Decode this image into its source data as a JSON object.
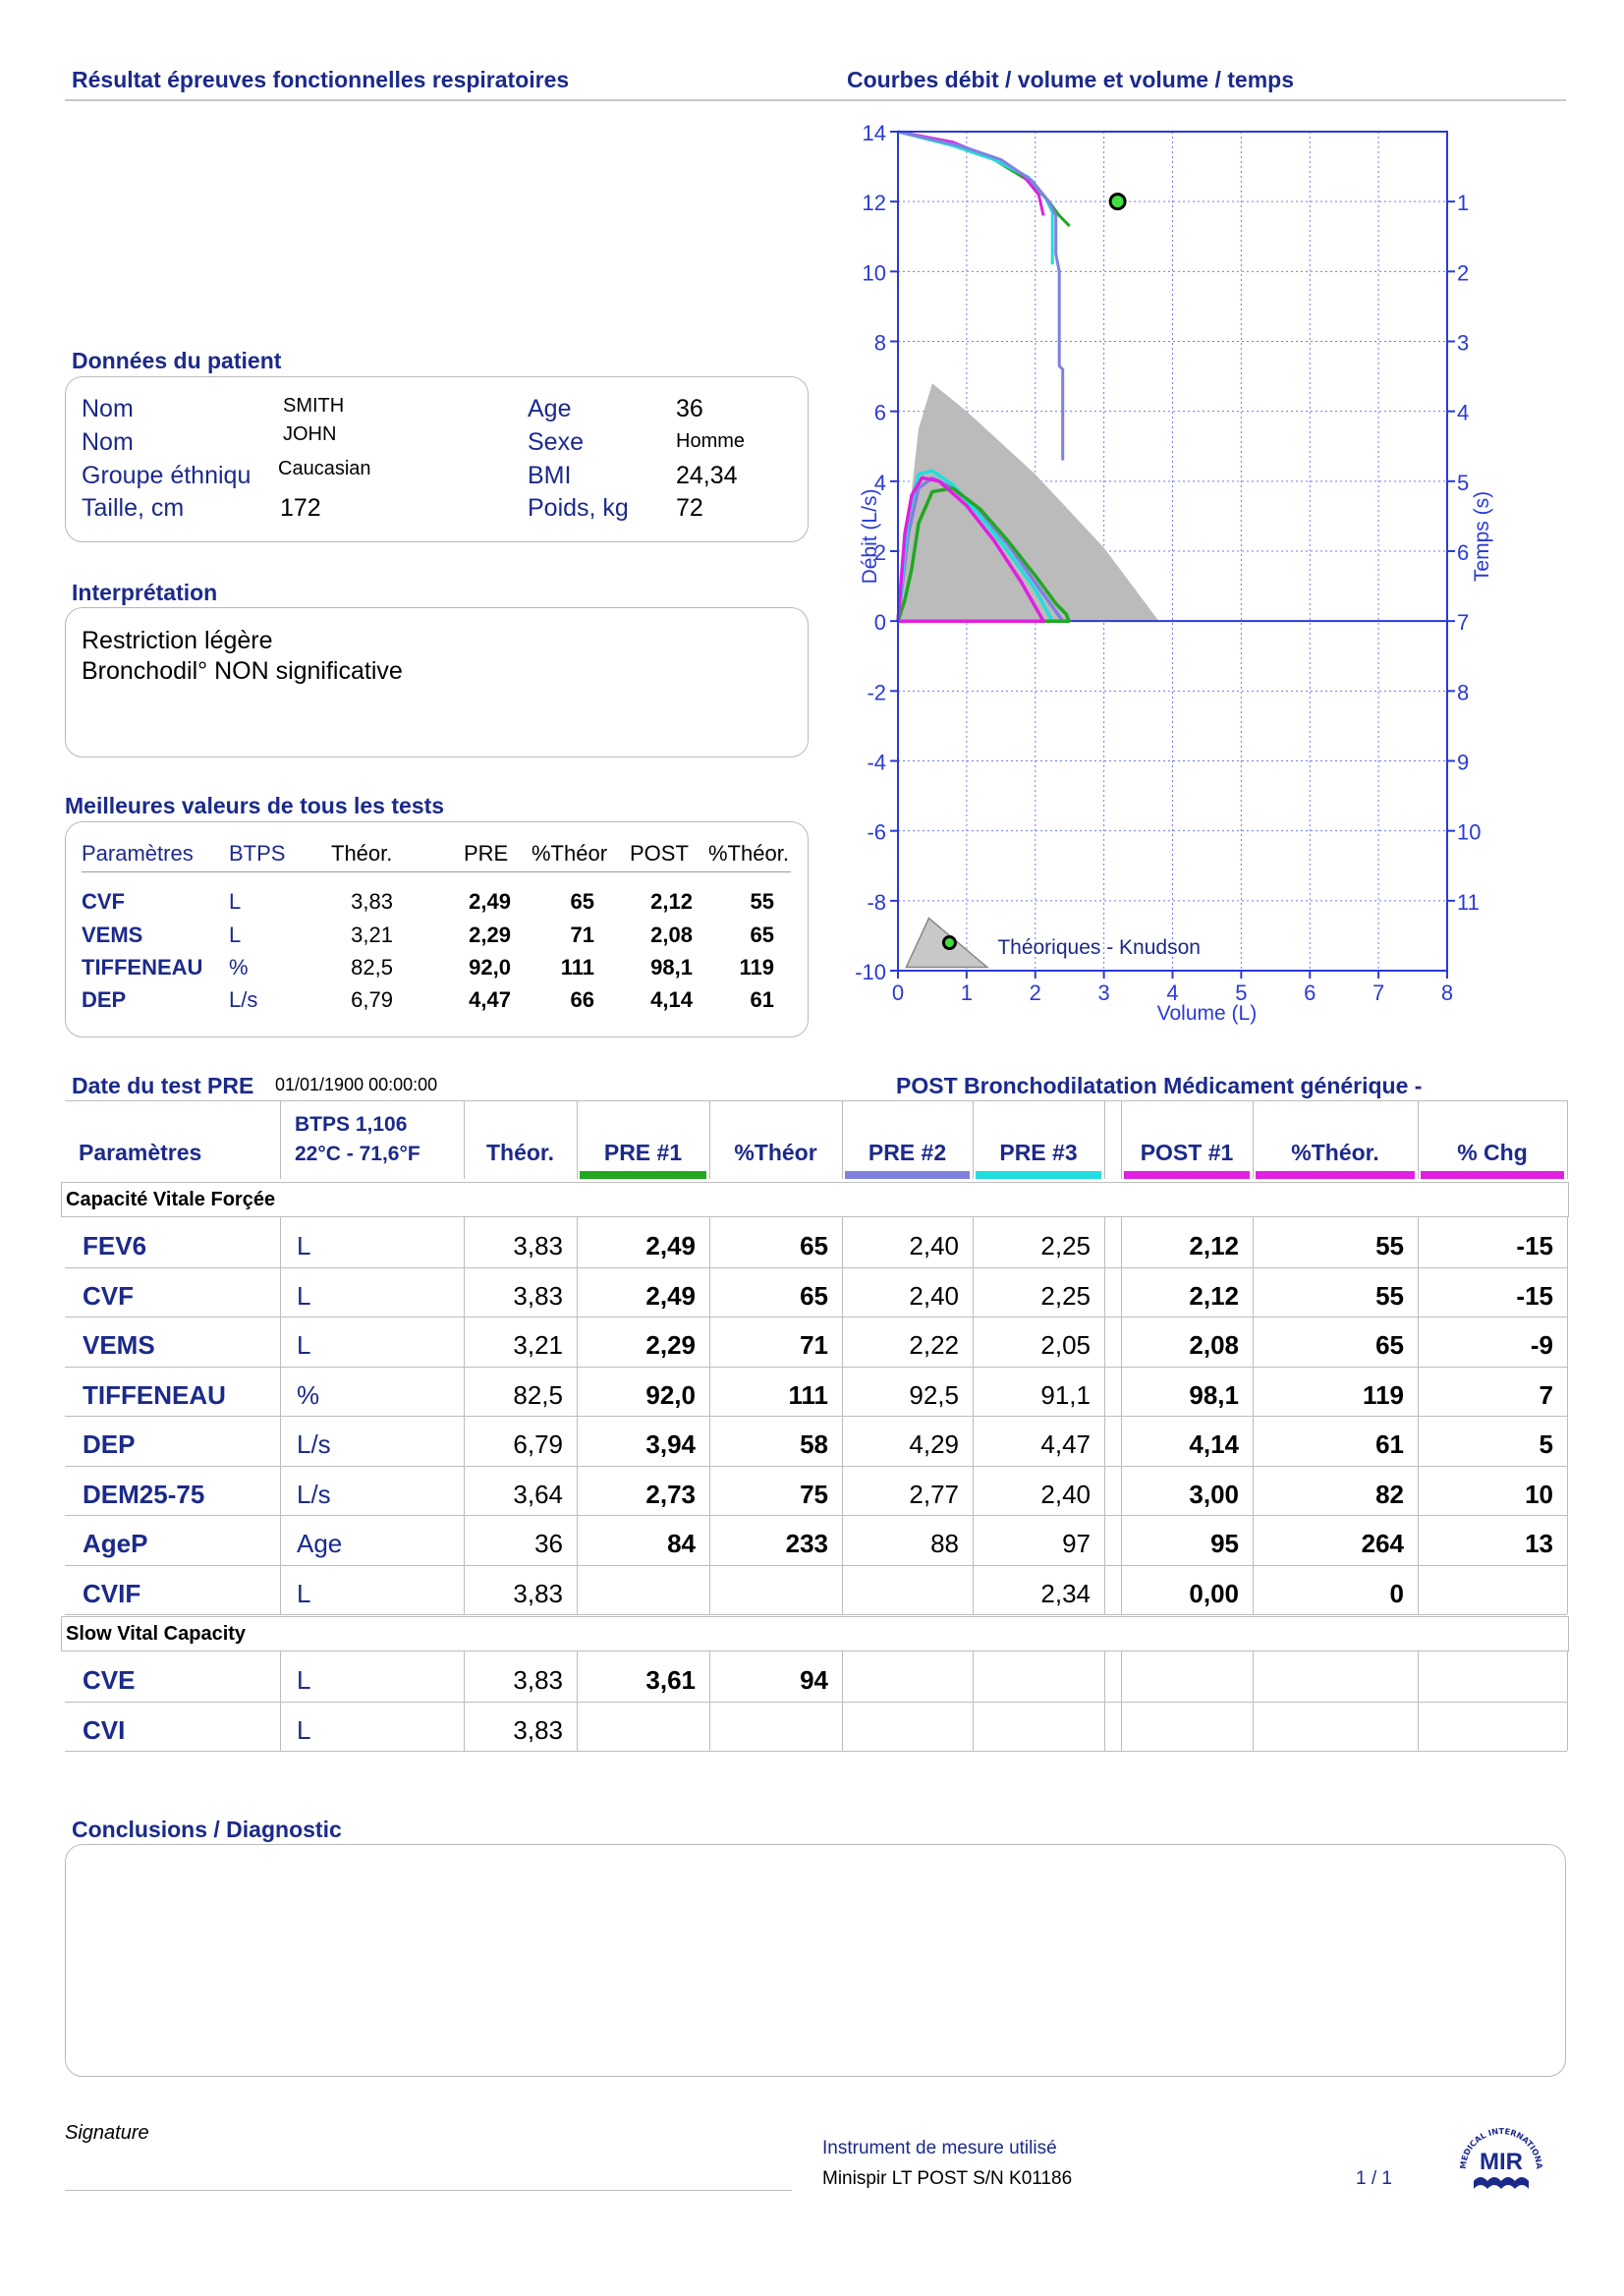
{
  "header": {
    "left_title": "Résultat épreuves fonctionnelles respiratoires",
    "right_title": "Courbes débit / volume et volume / temps"
  },
  "patient": {
    "section_title": "Données du patient",
    "labels": [
      "Nom",
      "Nom",
      "Groupe éthniqu",
      "Taille, cm"
    ],
    "values": [
      "SMITH",
      "JOHN",
      "Caucasian",
      "172"
    ],
    "labels2": [
      "Age",
      "Sexe",
      "BMI",
      "Poids, kg"
    ],
    "values2": [
      "36",
      "Homme",
      "24,34",
      "72"
    ]
  },
  "interpretation": {
    "section_title": "Interprétation",
    "line1": "Restriction légère",
    "line2": "Bronchodil° NON significative"
  },
  "best": {
    "section_title": "Meilleures valeurs de tous les tests",
    "headers": [
      "Paramètres",
      "BTPS",
      "Théor.",
      "PRE",
      "%Théor",
      "POST",
      "%Théor."
    ],
    "rows": [
      [
        "CVF",
        "L",
        "3,83",
        "2,49",
        "65",
        "2,12",
        "55"
      ],
      [
        "VEMS",
        "L",
        "3,21",
        "2,29",
        "71",
        "2,08",
        "65"
      ],
      [
        "TIFFENEAU",
        "%",
        "82,5",
        "92,0",
        "111",
        "98,1",
        "119"
      ],
      [
        "DEP",
        "L/s",
        "6,79",
        "4,47",
        "66",
        "4,14",
        "61"
      ]
    ]
  },
  "chart": {
    "left_axis_title": "Débit (L/s)",
    "right_axis_title": "Temps (s)",
    "x_axis_title": "Volume (L)",
    "legend_label": "Théoriques - Knudson",
    "colors": {
      "pre1": "#22a822",
      "pre2": "#8080e0",
      "pre3": "#22dddd",
      "post1": "#e020e0",
      "predicted": "#bbbbbb",
      "axis": "#2a3ad6"
    }
  },
  "chart_data": {
    "type": "line",
    "title": "Courbes débit / volume et volume / temps",
    "xlabel": "Volume (L)",
    "ylabel": "Débit (L/s)",
    "y2label": "Temps (s)",
    "xlim": [
      0,
      8
    ],
    "ylim": [
      -10,
      14
    ],
    "y2lim": [
      0,
      11
    ],
    "x_ticks": [
      "0",
      "1",
      "2",
      "3",
      "4",
      "5",
      "6",
      "7",
      "8"
    ],
    "y_ticks": [
      "14",
      "12",
      "10",
      "8",
      "6",
      "4",
      "2",
      "0",
      "-2",
      "-4",
      "-6",
      "-8",
      "-10"
    ],
    "y2_ticks": [
      "1",
      "2",
      "3",
      "4",
      "5",
      "6",
      "7",
      "8",
      "9",
      "10",
      "11"
    ],
    "grid": true,
    "predicted_point": {
      "x": 3.2,
      "y": 12.0
    },
    "series": [
      {
        "name": "Théoriques - Knudson",
        "type": "area",
        "x": [
          0,
          0.1,
          0.3,
          0.5,
          1.0,
          2.0,
          3.0,
          3.8
        ],
        "y": [
          0,
          2.0,
          5.5,
          6.8,
          6.0,
          4.2,
          2.1,
          0
        ]
      },
      {
        "name": "PRE #1",
        "color": "#22a822",
        "x": [
          0,
          0.1,
          0.2,
          0.3,
          0.5,
          0.8,
          1.2,
          1.6,
          2.0,
          2.3,
          2.45,
          2.49,
          0
        ],
        "y": [
          0,
          0.6,
          1.5,
          2.8,
          3.7,
          3.8,
          3.2,
          2.3,
          1.3,
          0.5,
          0.2,
          0,
          0
        ]
      },
      {
        "name": "PRE #2",
        "color": "#8080e0",
        "x": [
          0,
          0.15,
          0.3,
          0.5,
          0.8,
          1.2,
          1.6,
          2.0,
          2.4,
          0
        ],
        "y": [
          0,
          2.5,
          3.8,
          4.1,
          3.8,
          3.1,
          2.2,
          1.1,
          0,
          0
        ]
      },
      {
        "name": "PRE #3",
        "color": "#22dddd",
        "x": [
          0,
          0.15,
          0.3,
          0.5,
          0.8,
          1.2,
          1.6,
          2.0,
          2.25,
          0
        ],
        "y": [
          0,
          3.0,
          4.2,
          4.3,
          3.9,
          3.0,
          2.0,
          0.9,
          0,
          0
        ]
      },
      {
        "name": "POST #1",
        "color": "#e020e0",
        "x": [
          0,
          0.1,
          0.2,
          0.35,
          0.6,
          1.0,
          1.4,
          1.8,
          2.12,
          0
        ],
        "y": [
          0,
          2.5,
          3.6,
          4.1,
          4.0,
          3.3,
          2.3,
          1.1,
          0,
          0
        ]
      }
    ]
  },
  "test": {
    "date_label": "Date du test PRE",
    "date_value": "01/01/1900 00:00:00",
    "post_title": "POST Bronchodilatation Médicament  générique -",
    "headers": {
      "param": "Paramètres",
      "btps1": "BTPS 1,106",
      "btps2": "22°C - 71,6°F",
      "theor": "Théor.",
      "pre1": "PRE #1",
      "ptheor": "%Théor",
      "pre2": "PRE #2",
      "pre3": "PRE #3",
      "post1": "POST #1",
      "ptheor2": "%Théor.",
      "chg": "% Chg"
    },
    "group1": "Capacité Vitale Forçée",
    "group2": "Slow Vital Capacity",
    "rows_fvc": [
      [
        "FEV6",
        "L",
        "3,83",
        "2,49",
        "65",
        "2,40",
        "2,25",
        "2,12",
        "55",
        "-15"
      ],
      [
        "CVF",
        "L",
        "3,83",
        "2,49",
        "65",
        "2,40",
        "2,25",
        "2,12",
        "55",
        "-15"
      ],
      [
        "VEMS",
        "L",
        "3,21",
        "2,29",
        "71",
        "2,22",
        "2,05",
        "2,08",
        "65",
        "-9"
      ],
      [
        "TIFFENEAU",
        "%",
        "82,5",
        "92,0",
        "111",
        "92,5",
        "91,1",
        "98,1",
        "119",
        "7"
      ],
      [
        "DEP",
        "L/s",
        "6,79",
        "3,94",
        "58",
        "4,29",
        "4,47",
        "4,14",
        "61",
        "5"
      ],
      [
        "DEM25-75",
        "L/s",
        "3,64",
        "2,73",
        "75",
        "2,77",
        "2,40",
        "3,00",
        "82",
        "10"
      ],
      [
        "AgeP",
        "Age",
        "36",
        "84",
        "233",
        "88",
        "97",
        "95",
        "264",
        "13"
      ],
      [
        "CVIF",
        "L",
        "3,83",
        "",
        "",
        "",
        "2,34",
        "0,00",
        "0",
        ""
      ]
    ],
    "rows_svc": [
      [
        "CVE",
        "L",
        "3,83",
        "3,61",
        "94",
        "",
        "",
        "",
        "",
        ""
      ],
      [
        "CVI",
        "L",
        "3,83",
        "",
        "",
        "",
        "",
        "",
        "",
        ""
      ]
    ]
  },
  "conclusions": {
    "section_title": "Conclusions / Diagnostic"
  },
  "footer": {
    "signature": "Signature",
    "instrument_label": "Instrument de mesure utilisé",
    "instrument": "Minispir LT POST S/N K01186",
    "page": "1 / 1",
    "logo_text": "MIR",
    "logo_ring": "MEDICAL INTERNATIONAL RESEARCH"
  }
}
